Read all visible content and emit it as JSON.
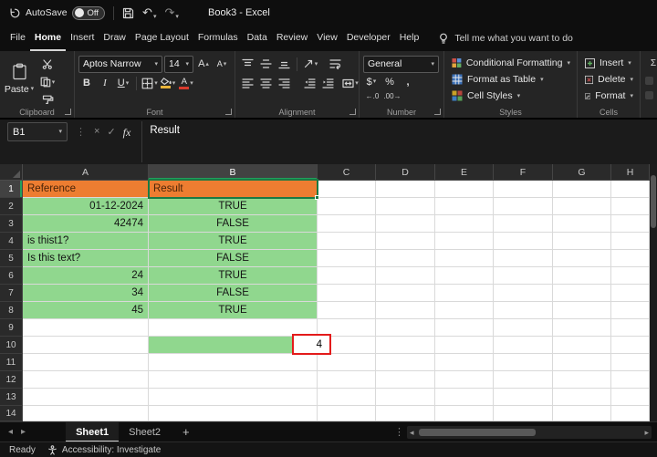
{
  "titlebar": {
    "autosave_label": "AutoSave",
    "autosave_state": "Off",
    "title": "Book3 - Excel"
  },
  "ribbon_tabs": {
    "items": [
      "File",
      "Home",
      "Insert",
      "Draw",
      "Page Layout",
      "Formulas",
      "Data",
      "Review",
      "View",
      "Developer",
      "Help"
    ],
    "active": "Home",
    "tell_me": "Tell me what you want to do"
  },
  "ribbon": {
    "clipboard": {
      "group_label": "Clipboard",
      "paste_label": "Paste"
    },
    "font": {
      "group_label": "Font",
      "font_name": "Aptos Narrow",
      "font_size": "14",
      "bold": "B",
      "italic": "I",
      "underline": "U"
    },
    "alignment": {
      "group_label": "Alignment"
    },
    "number": {
      "group_label": "Number",
      "format": "General",
      "currency": "$",
      "percent": "%",
      "comma": ",",
      "increase_decimal": "←.0",
      "decrease_decimal": ".00→"
    },
    "styles": {
      "group_label": "Styles",
      "items": [
        "Conditional Formatting",
        "Format as Table",
        "Cell Styles"
      ]
    },
    "cells": {
      "group_label": "Cells",
      "items": [
        "Insert",
        "Delete",
        "Format"
      ]
    }
  },
  "formula_bar": {
    "name_box": "B1",
    "cancel": "×",
    "enter": "✓",
    "fx": "fx",
    "content": "Result"
  },
  "grid": {
    "columns": [
      "A",
      "B",
      "C",
      "D",
      "E",
      "F",
      "G",
      "H"
    ],
    "row_count": 14,
    "selected_cell": "B1",
    "header_row": {
      "a": "Reference",
      "b": "Result"
    },
    "data_rows": [
      {
        "row": 2,
        "a": "01-12-2024",
        "a_align": "right",
        "b": "TRUE"
      },
      {
        "row": 3,
        "a": "42474",
        "a_align": "right",
        "b": "FALSE"
      },
      {
        "row": 4,
        "a": "is thist1?",
        "a_align": "left",
        "b": "TRUE"
      },
      {
        "row": 5,
        "a": "Is this text?",
        "a_align": "left",
        "b": "FALSE"
      },
      {
        "row": 6,
        "a": "24",
        "a_align": "right",
        "b": "TRUE"
      },
      {
        "row": 7,
        "a": "34",
        "a_align": "right",
        "b": "FALSE"
      },
      {
        "row": 8,
        "a": "45",
        "a_align": "right",
        "b": "TRUE"
      }
    ],
    "annotated_cell": {
      "row": 10,
      "col": "B",
      "value": "4"
    },
    "colors": {
      "header_fill": "#ED7D31",
      "data_fill": "#90D78E",
      "selection_border": "#1A7A44",
      "annotation_border": "#E31B1B"
    }
  },
  "sheets": {
    "tabs": [
      "Sheet1",
      "Sheet2"
    ],
    "active": "Sheet1",
    "add_label": "+"
  },
  "status_bar": {
    "mode": "Ready",
    "accessibility": "Accessibility: Investigate"
  },
  "icons": {
    "dropdown": "▾",
    "caret_up": "▴",
    "undo": "↶",
    "redo": "↷",
    "vertical_ellipsis": "⋮",
    "nav_left": "◂",
    "nav_right": "▸",
    "letter_A": "A",
    "sigma": "Σ"
  }
}
